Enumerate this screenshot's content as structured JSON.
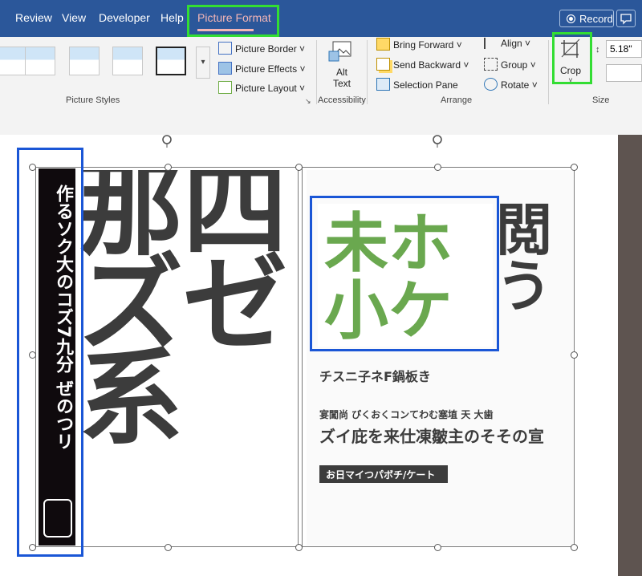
{
  "tabs": [
    "Review",
    "View",
    "Developer",
    "Help",
    "Picture Format"
  ],
  "record": {
    "label": "Record"
  },
  "picture_styles": {
    "label": "Picture Styles",
    "border": "Picture Border",
    "effects": "Picture Effects",
    "layout": "Picture Layout"
  },
  "accessibility": {
    "label": "Accessibility",
    "alt_line1": "Alt",
    "alt_line2": "Text"
  },
  "arrange": {
    "label": "Arrange",
    "bring_forward": "Bring Forward",
    "send_backward": "Send Backward",
    "selection_pane": "Selection Pane",
    "align": "Align",
    "group": "Group",
    "rotate": "Rotate"
  },
  "size": {
    "label": "Size",
    "crop": "Crop",
    "height": "5.18\""
  },
  "poster": {
    "left_strip_text": "作るソク大のコズ7九分 ぜのつリ",
    "middle_big_text": "那四ズゼ系",
    "right_headline": "未ホ 小ケ",
    "right_subtext": "閲う",
    "line1": "チスニ子ネF鍋板き",
    "line2": "宴闖尚 ぴくおくコンてわむ塞埴 天 大歯",
    "line3": "ズイ庇を来仕凍皺主のそその宣",
    "line4": "お日マイつパボチ/ケート"
  },
  "colors": {
    "accent_green": "#33dd33",
    "selection_blue": "#1a56d6",
    "crop_green": "#6aa84f",
    "ink": "#3c3c3c"
  }
}
